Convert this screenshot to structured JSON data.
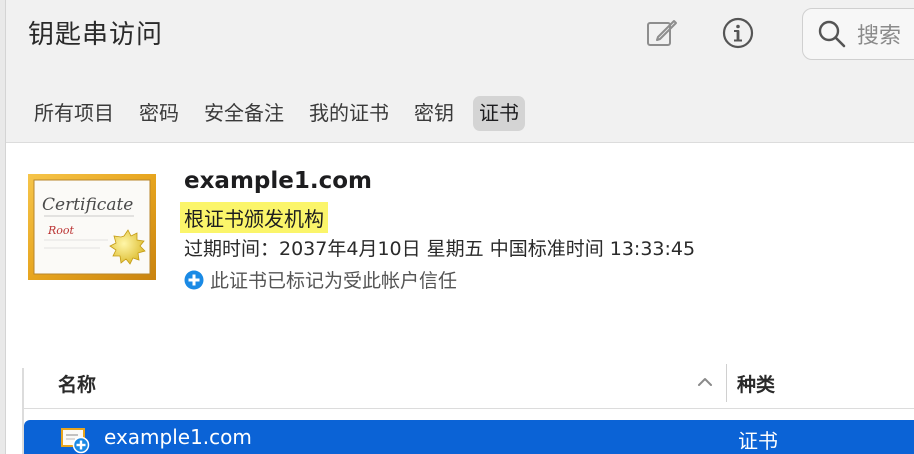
{
  "app": {
    "title": "钥匙串访问"
  },
  "toolbar": {
    "edit_icon": "edit-icon",
    "info_icon": "info-icon",
    "search_placeholder": "搜索"
  },
  "tabs": [
    {
      "label": "所有项目"
    },
    {
      "label": "密码"
    },
    {
      "label": "安全备注"
    },
    {
      "label": "我的证书"
    },
    {
      "label": "密钥"
    },
    {
      "label": "证书",
      "active": true
    }
  ],
  "detail": {
    "icon": "certificate-root-icon",
    "name": "example1.com",
    "kind": "根证书颁发机构",
    "expiry": "过期时间：2037年4月10日 星期五 中国标准时间 13:33:45",
    "trust": "此证书已标记为受此帐户信任"
  },
  "table": {
    "columns": [
      {
        "label": "名称"
      },
      {
        "label": "种类"
      }
    ],
    "rows": [
      {
        "name": "example1.com",
        "kind": "证书",
        "selected": true
      }
    ]
  },
  "colors": {
    "selection": "#0b63d6",
    "highlight": "#fbf56a",
    "trust_badge": "#1a8ae5"
  }
}
